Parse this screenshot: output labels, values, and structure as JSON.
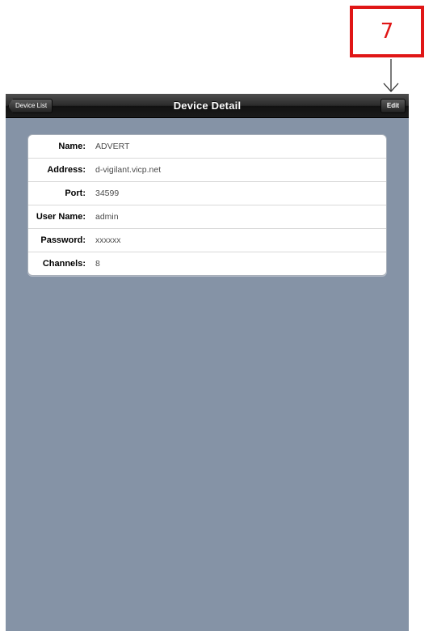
{
  "callout": {
    "number": "7",
    "color": "#e01616"
  },
  "navbar": {
    "back_label": "Device List",
    "title": "Device Detail",
    "edit_label": "Edit"
  },
  "details": [
    {
      "label": "Name:",
      "value": "ADVERT"
    },
    {
      "label": "Address:",
      "value": "d-vigilant.vicp.net"
    },
    {
      "label": "Port:",
      "value": "34599"
    },
    {
      "label": "User Name:",
      "value": "admin"
    },
    {
      "label": "Password:",
      "value": "xxxxxx"
    },
    {
      "label": "Channels:",
      "value": "8"
    }
  ],
  "colors": {
    "background": "#8593a6",
    "navbar": "#1b1b1b"
  }
}
